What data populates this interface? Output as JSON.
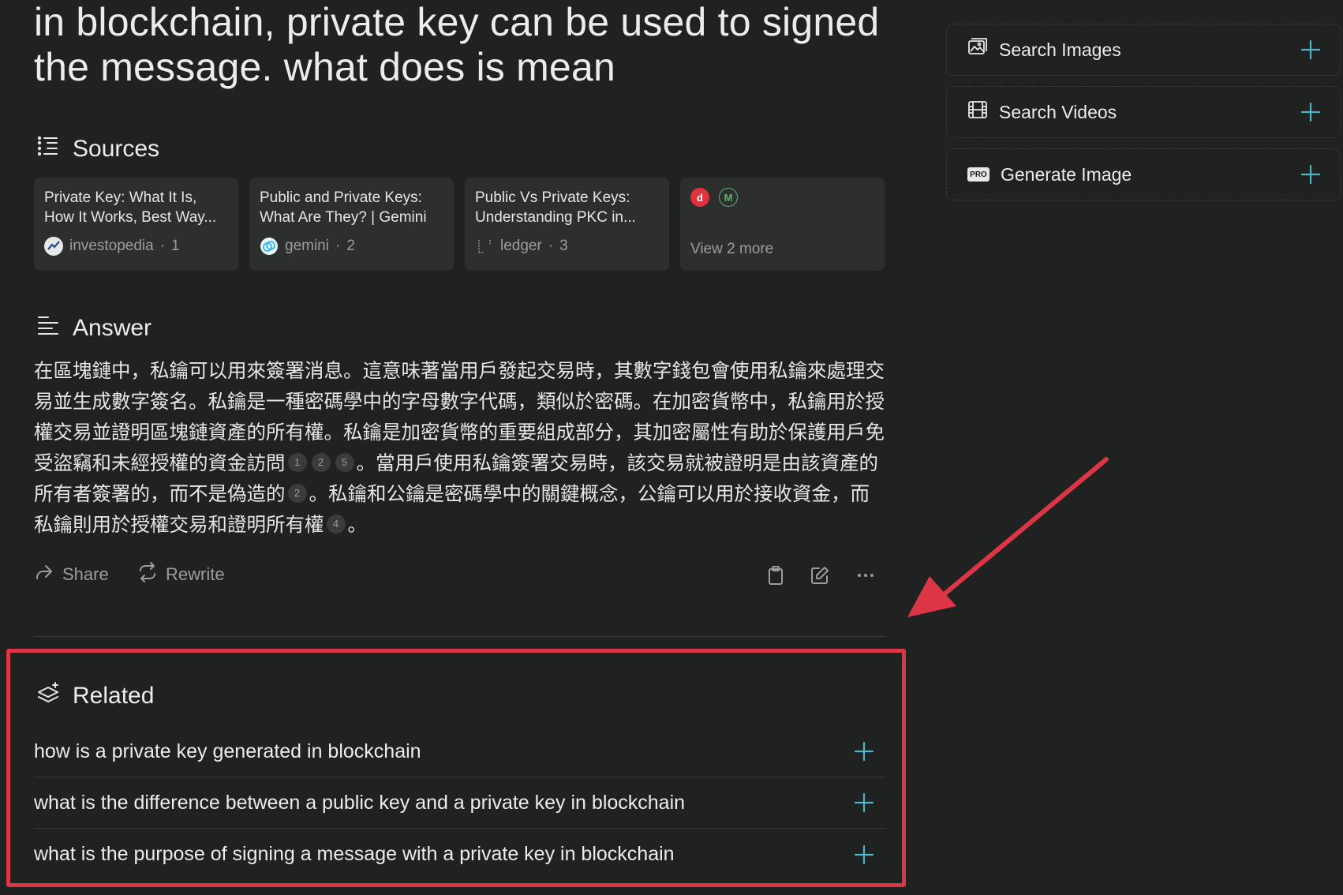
{
  "question": "in blockchain, private key can be used to signed the message. what does is mean",
  "sources": {
    "heading": "Sources",
    "cards": [
      {
        "title": "Private Key: What It Is, How It Works, Best Way...",
        "site": "investopedia",
        "index": "1"
      },
      {
        "title": "Public and Private Keys: What Are They? | Gemini",
        "site": "gemini",
        "index": "2"
      },
      {
        "title": "Public Vs Private Keys: Understanding PKC in...",
        "site": "ledger",
        "index": "3"
      }
    ],
    "more": {
      "label": "View 2 more",
      "favicons": [
        "d",
        "M"
      ]
    }
  },
  "answer": {
    "heading": "Answer",
    "part1": "在區塊鏈中，私鑰可以用來簽署消息。這意味著當用戶發起交易時，其數字錢包會使用私鑰來處理交易並生成數字簽名。私鑰是一種密碼學中的字母數字代碼，類似於密碼。在加密貨幣中，私鑰用於授權交易並證明區塊鏈資產的所有權。私鑰是加密貨幣的重要組成部分，其加密屬性有助於保護用戶免受盜竊和未經授權的資金訪問",
    "cites1": [
      "1",
      "2",
      "5"
    ],
    "part2": "。當用戶使用私鑰簽署交易時，該交易就被證明是由該資產的所有者簽署的，而不是偽造的",
    "cites2": [
      "2"
    ],
    "part3": "。私鑰和公鑰是密碼學中的關鍵概念，公鑰可以用於接收資金，而私鑰則用於授權交易和證明所有權",
    "cites3": [
      "4"
    ],
    "part4": "。"
  },
  "actions": {
    "share": "Share",
    "rewrite": "Rewrite"
  },
  "related": {
    "heading": "Related",
    "items": [
      "how is a private key generated in blockchain",
      "what is the difference between a public key and a private key in blockchain",
      "what is the purpose of signing a message with a private key in blockchain"
    ]
  },
  "sidebar": {
    "items": [
      {
        "label": "Search Images",
        "icon": "image-icon"
      },
      {
        "label": "Search Videos",
        "icon": "film-icon"
      },
      {
        "label": "Generate Image",
        "icon": "pro-badge-icon",
        "badge": "PRO"
      }
    ]
  },
  "colors": {
    "accent": "#4fb3c9",
    "highlight": "#dc3545",
    "background": "#202221",
    "card": "#2d2f2e"
  }
}
